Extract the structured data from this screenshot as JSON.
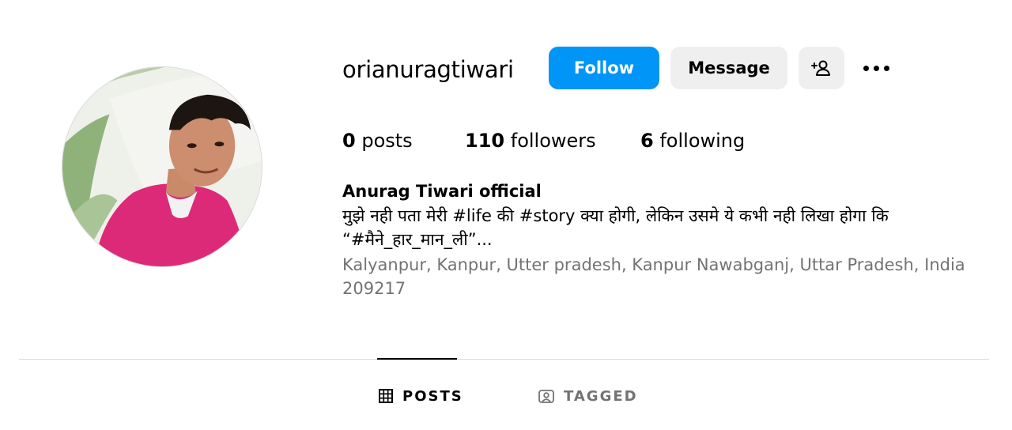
{
  "profile": {
    "username": "orianuragtiwari",
    "full_name": "Anurag Tiwari official",
    "bio_line1": "मुझे नही पता मेरी #life की #story क्या होगी, लेकिन उसमे ये कभी नही लिखा होगा कि",
    "bio_line2": "“#मैने_हार_मान_ली”...",
    "location": "Kalyanpur, Kanpur, Utter pradesh, Kanpur Nawabganj, Uttar Pradesh, India 209217"
  },
  "actions": {
    "follow_label": "Follow",
    "message_label": "Message",
    "add_user_icon": "person-plus-icon",
    "more_icon": "ellipsis-icon"
  },
  "stats": {
    "posts_count": "0",
    "posts_label": "posts",
    "followers_count": "110",
    "followers_label": "followers",
    "following_count": "6",
    "following_label": "following"
  },
  "tabs": [
    {
      "label": "POSTS",
      "icon": "grid-icon",
      "active": true
    },
    {
      "label": "TAGGED",
      "icon": "tagged-icon",
      "active": false
    }
  ],
  "colors": {
    "primary_button": "#0095f6",
    "secondary_button": "#efefef",
    "muted_text": "#737373",
    "divider": "#dbdbdb"
  }
}
